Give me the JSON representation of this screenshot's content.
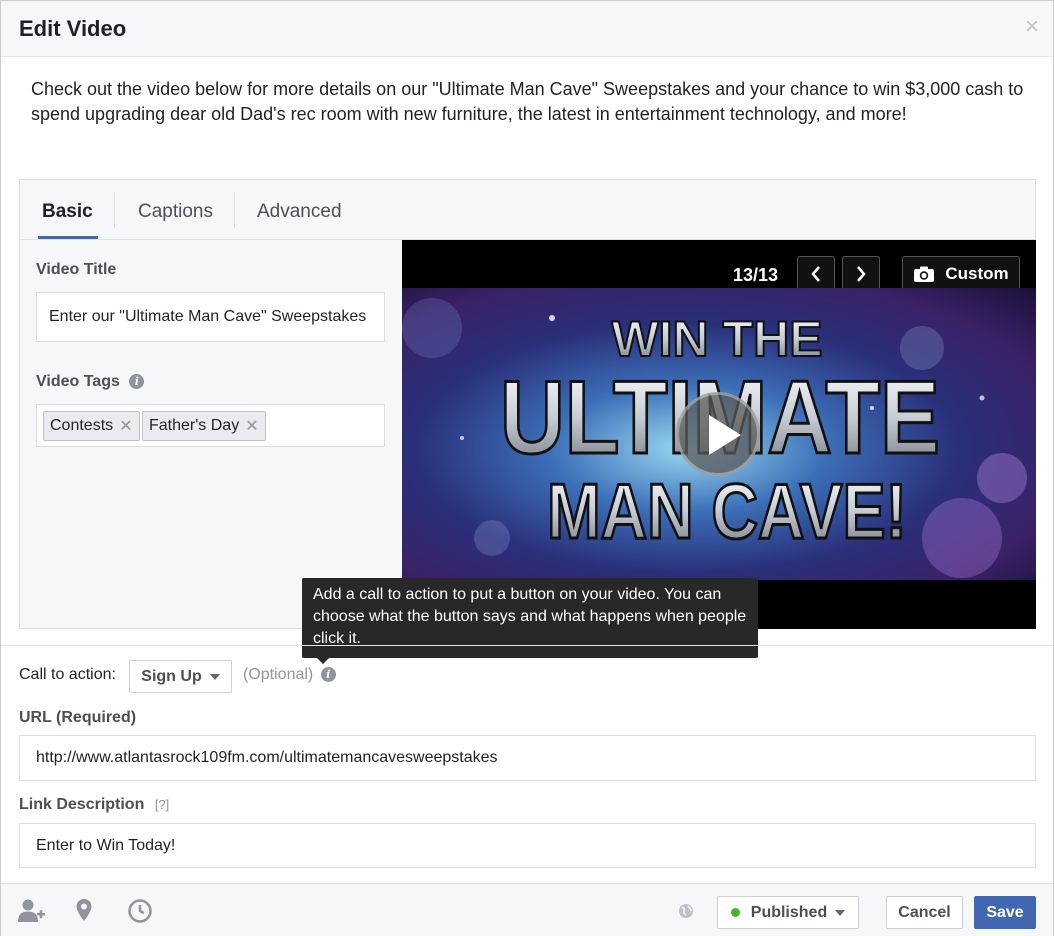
{
  "dialog": {
    "title": "Edit Video",
    "close_symbol": "×"
  },
  "description": {
    "text": "Check out the video below for more details on our \"Ultimate Man Cave\" Sweepstakes and your chance to win $3,000 cash to spend upgrading dear old Dad's rec room with new furniture, the latest in entertainment technology, and more!"
  },
  "tabs": [
    {
      "label": "Basic",
      "active": true
    },
    {
      "label": "Captions",
      "active": false
    },
    {
      "label": "Advanced",
      "active": false
    }
  ],
  "basic": {
    "video_title_label": "Video Title",
    "video_title_value": "Enter our \"Ultimate Man Cave\" Sweepstakes",
    "video_tags_label": "Video Tags",
    "tags": [
      "Contests",
      "Father's Day"
    ]
  },
  "video": {
    "counter": "13/13",
    "custom_label": "Custom",
    "thumb_text": {
      "line1": "WIN THE",
      "line2": "ULTIMATE",
      "line3": "MAN CAVE!"
    }
  },
  "tooltip": {
    "text": "Add a call to action to put a button on your video. You can choose what the button says and what happens when people click it."
  },
  "cta": {
    "label": "Call to action:",
    "selected": "Sign Up",
    "optional": "(Optional)"
  },
  "url": {
    "label": "URL (Required)",
    "value": "http://www.atlantasrock109fm.com/ultimatemancavesweepstakes"
  },
  "link_description": {
    "label": "Link Description",
    "help": "[?]",
    "value": "Enter to Win Today!"
  },
  "footer": {
    "status": "Published",
    "cancel": "Cancel",
    "save": "Save",
    "icons": [
      "tag-people-icon",
      "location-pin-icon",
      "clock-icon",
      "globe-icon"
    ]
  },
  "colors": {
    "accent": "#4267b2",
    "published_dot": "#42b72a",
    "tooltip_bg": "#282828"
  }
}
